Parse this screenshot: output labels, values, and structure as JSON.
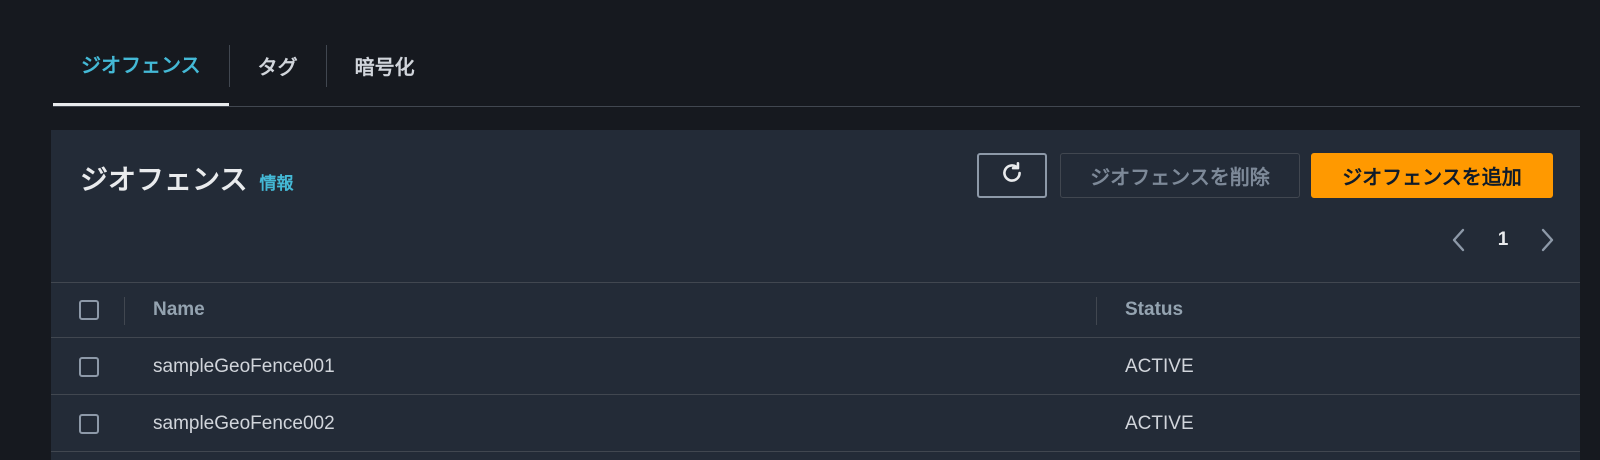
{
  "tabs": [
    {
      "label": "ジオフェンス",
      "active": true
    },
    {
      "label": "タグ",
      "active": false
    },
    {
      "label": "暗号化",
      "active": false
    }
  ],
  "panel": {
    "title": "ジオフェンス",
    "info_link": "情報",
    "refresh_icon": "refresh-icon",
    "delete_label": "ジオフェンスを削除",
    "add_label": "ジオフェンスを追加"
  },
  "pagination": {
    "current_page": "1",
    "prev_icon": "chevron-left-icon",
    "next_icon": "chevron-right-icon"
  },
  "table": {
    "columns": [
      "Name",
      "Status"
    ],
    "rows": [
      {
        "name": "sampleGeoFence001",
        "status": "ACTIVE"
      },
      {
        "name": "sampleGeoFence002",
        "status": "ACTIVE"
      }
    ]
  },
  "colors": {
    "accent": "#44b9d6",
    "primary_button": "#ff9900",
    "background": "#16191f",
    "panel": "#232b37"
  }
}
